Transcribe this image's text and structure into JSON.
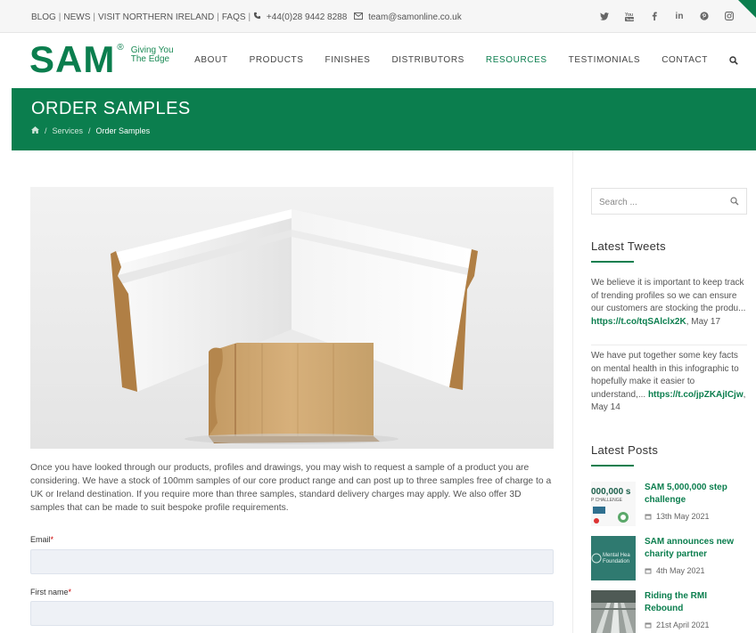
{
  "topbar": {
    "links": [
      "BLOG",
      "NEWS",
      "VISIT NORTHERN IRELAND",
      "FAQS"
    ],
    "phone": "+44(0)28 9442 8288",
    "email": "team@samonline.co.uk",
    "social": [
      "twitter-icon",
      "youtube-icon",
      "facebook-icon",
      "linkedin-icon",
      "pinterest-icon",
      "instagram-icon"
    ]
  },
  "brand": {
    "logo": "SAM",
    "reg": "®",
    "tagline_1": "Giving You",
    "tagline_2": "The Edge",
    "accent": "#0b7e4e"
  },
  "nav": {
    "items": [
      "ABOUT",
      "PRODUCTS",
      "FINISHES",
      "DISTRIBUTORS",
      "RESOURCES",
      "TESTIMONIALS",
      "CONTACT"
    ],
    "active": "RESOURCES"
  },
  "page": {
    "title": "ORDER SAMPLES",
    "breadcrumb": [
      "Services",
      "Order Samples"
    ]
  },
  "content": {
    "intro": "Once you have looked through our products, profiles and drawings, you may wish to request a sample of a product you are considering.  We have a stock of 100mm samples of our core product range and can post up to three samples free of charge to a UK or Ireland destination.  If you require more than three samples, standard delivery charges may apply. We also offer 3D samples that can be made to suit bespoke profile requirements.",
    "form": {
      "email_label": "Email",
      "first_name_label": "First name",
      "required_mark": "*"
    }
  },
  "sidebar": {
    "search_placeholder": "Search ...",
    "tweets_heading": "Latest Tweets",
    "tweets": [
      {
        "text": "We believe it is important to keep track of trending profiles so we can ensure our customers are stocking the produ... ",
        "link": "https://t.co/tqSAlclx2K",
        "date": ", May 17"
      },
      {
        "text": "We have put together some key facts on mental health in this infographic to hopefully make it easier to understand,... ",
        "link": "https://t.co/jpZKAjICjw",
        "date": ", May 14"
      }
    ],
    "posts_heading": "Latest Posts",
    "posts": [
      {
        "title": "SAM 5,000,000 step challenge",
        "date": "13th May 2021",
        "thumb_text": "000,000 s",
        "thumb_sub": "P CHALLENGE"
      },
      {
        "title": "SAM announces new charity partner",
        "date": "4th May 2021",
        "thumb_text": "Mental Hea",
        "thumb_sub": "Foundation"
      },
      {
        "title": "Riding the RMI Rebound",
        "date": "21st April 2021",
        "thumb_text": "",
        "thumb_sub": ""
      }
    ]
  }
}
